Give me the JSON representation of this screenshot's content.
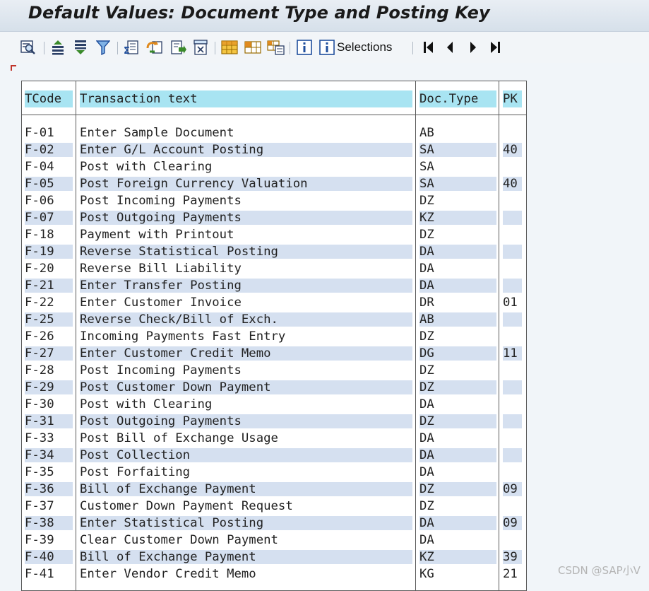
{
  "title": "Default Values: Document Type and Posting Key",
  "toolbar": {
    "selections_label": "Selections"
  },
  "table": {
    "headers": [
      "TCode",
      "Transaction text",
      "Doc.Type",
      "PK"
    ],
    "rows": [
      [
        "F-01",
        "Enter Sample Document",
        "AB",
        ""
      ],
      [
        "F-02",
        "Enter G/L Account Posting",
        "SA",
        "40"
      ],
      [
        "F-04",
        "Post with Clearing",
        "SA",
        ""
      ],
      [
        "F-05",
        "Post Foreign Currency Valuation",
        "SA",
        "40"
      ],
      [
        "F-06",
        "Post Incoming Payments",
        "DZ",
        ""
      ],
      [
        "F-07",
        "Post Outgoing Payments",
        "KZ",
        ""
      ],
      [
        "F-18",
        "Payment with Printout",
        "DZ",
        ""
      ],
      [
        "F-19",
        "Reverse Statistical Posting",
        "DA",
        ""
      ],
      [
        "F-20",
        "Reverse Bill Liability",
        "DA",
        ""
      ],
      [
        "F-21",
        "Enter Transfer Posting",
        "DA",
        ""
      ],
      [
        "F-22",
        "Enter Customer Invoice",
        "DR",
        "01"
      ],
      [
        "F-25",
        "Reverse Check/Bill of Exch.",
        "AB",
        ""
      ],
      [
        "F-26",
        "Incoming Payments Fast Entry",
        "DZ",
        ""
      ],
      [
        "F-27",
        "Enter Customer Credit Memo",
        "DG",
        "11"
      ],
      [
        "F-28",
        "Post Incoming Payments",
        "DZ",
        ""
      ],
      [
        "F-29",
        "Post Customer Down Payment",
        "DZ",
        ""
      ],
      [
        "F-30",
        "Post with Clearing",
        "DA",
        ""
      ],
      [
        "F-31",
        "Post Outgoing Payments",
        "DZ",
        ""
      ],
      [
        "F-33",
        "Post Bill of Exchange Usage",
        "DA",
        ""
      ],
      [
        "F-34",
        "Post Collection",
        "DA",
        ""
      ],
      [
        "F-35",
        "Post Forfaiting",
        "DA",
        ""
      ],
      [
        "F-36",
        "Bill of Exchange Payment",
        "DZ",
        "09"
      ],
      [
        "F-37",
        "Customer Down Payment Request",
        "DZ",
        ""
      ],
      [
        "F-38",
        "Enter Statistical Posting",
        "DA",
        "09"
      ],
      [
        "F-39",
        "Clear Customer Down Payment",
        "DA",
        ""
      ],
      [
        "F-40",
        "Bill of Exchange Payment",
        "KZ",
        "39"
      ],
      [
        "F-41",
        "Enter Vendor Credit Memo",
        "KG",
        "21"
      ]
    ]
  },
  "watermark": "CSDN @SAP小V",
  "colors": {
    "header_cell": "#a8e4f2",
    "alt_row": "#d5e0f0",
    "toolbar_icon_blue": "#1f4e9c",
    "toolbar_icon_green": "#3a8a2a",
    "toolbar_icon_orange": "#e08a1e"
  }
}
